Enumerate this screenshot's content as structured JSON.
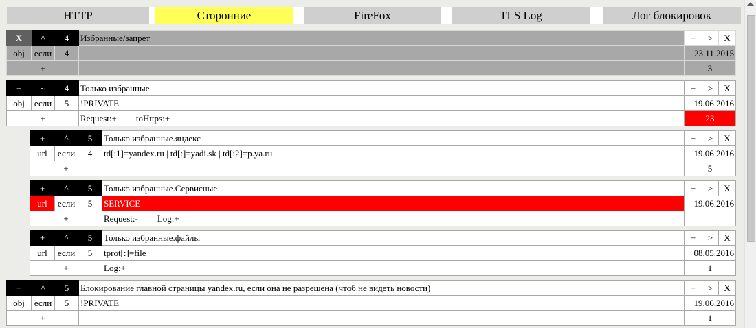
{
  "tabs": [
    {
      "label": "HTTP",
      "active": false
    },
    {
      "label": "Сторонние",
      "active": true
    },
    {
      "label": "FireFox",
      "active": false
    },
    {
      "label": "TLS Log",
      "active": false
    },
    {
      "label": "Лог блокировок",
      "active": false
    }
  ],
  "colors": {
    "active_tab": "#ffff55",
    "highlight": "#ff0000",
    "header_bg": "#000000",
    "group_bg": "#a8a8a8"
  },
  "icons": {
    "add": "+",
    "up": "^",
    "tilde": "~",
    "close": "X",
    "next": ">"
  },
  "rules": [
    {
      "toggle": "X",
      "arrow": "^",
      "level": "4",
      "title": "Избранные/запрет",
      "type": "obj",
      "cond": "если",
      "cond_level": "4",
      "value": "",
      "date": "23.11.2015",
      "add": "+",
      "options": "",
      "options2": "",
      "count": "3"
    },
    {
      "toggle": "+",
      "arrow": "~",
      "level": "4",
      "title": "Только избранные",
      "type": "obj",
      "cond": "если",
      "cond_level": "5",
      "value": "!PRIVATE",
      "date": "19.06.2016",
      "add": "+",
      "options": "Request:+",
      "options2": "toHttps:+",
      "count": "23"
    },
    {
      "toggle": "+",
      "arrow": "^",
      "level": "5",
      "title": "Только избранные.яндекс",
      "type": "url",
      "cond": "если",
      "cond_level": "4",
      "value": "td[:1]=yandex.ru | td[:]=yadi.sk | td[:2]=p.ya.ru",
      "date": "19.06.2016",
      "add": "+",
      "options": "",
      "options2": "",
      "count": "5"
    },
    {
      "toggle": "+",
      "arrow": "^",
      "level": "5",
      "title": "Только избранные.Сервисные",
      "type": "url",
      "cond": "если",
      "cond_level": "5",
      "value": "SERVICE",
      "date": "19.06.2016",
      "add": "+",
      "options": "Request:-",
      "options2": "Log:+",
      "count": ""
    },
    {
      "toggle": "+",
      "arrow": "^",
      "level": "5",
      "title": "Только избранные.файлы",
      "type": "url",
      "cond": "если",
      "cond_level": "5",
      "value": "tprot[:]=file",
      "date": "08.05.2016",
      "add": "+",
      "options": "Log:+",
      "options2": "",
      "count": "1"
    },
    {
      "toggle": "+",
      "arrow": "^",
      "level": "5",
      "title": "Блокирование главной страницы yandex.ru, если она не разрешена (чтоб не видеть новости)",
      "type": "obj",
      "cond": "если",
      "cond_level": "5",
      "value": "!PRIVATE",
      "date": "19.06.2016",
      "add": "+",
      "options": "",
      "options2": "",
      "count": "1"
    }
  ]
}
